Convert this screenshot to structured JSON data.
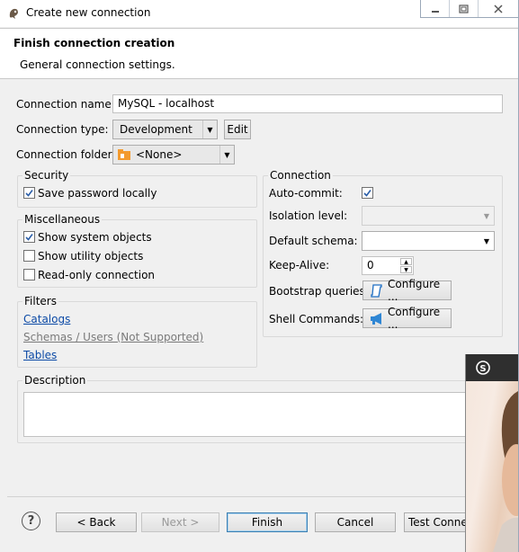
{
  "window": {
    "title": "Create new connection"
  },
  "header": {
    "title": "Finish connection creation",
    "subtitle": "General connection settings."
  },
  "form": {
    "connection_name_label": "Connection name:",
    "connection_name_value": "MySQL - localhost",
    "connection_type_label": "Connection type:",
    "connection_type_value": "Development",
    "edit_label": "Edit",
    "connection_folder_label": "Connection folder:",
    "connection_folder_value": "<None>"
  },
  "security": {
    "title": "Security",
    "save_password_label": "Save password locally",
    "save_password_checked": true
  },
  "misc": {
    "title": "Miscellaneous",
    "items": [
      {
        "label": "Show system objects",
        "checked": true
      },
      {
        "label": "Show utility objects",
        "checked": false
      },
      {
        "label": "Read-only connection",
        "checked": false
      }
    ]
  },
  "filters": {
    "title": "Filters",
    "catalogs": "Catalogs",
    "schemas": "Schemas / Users (Not Supported)",
    "tables": "Tables"
  },
  "connection": {
    "title": "Connection",
    "autocommit_label": "Auto-commit:",
    "autocommit_checked": true,
    "isolation_label": "Isolation level:",
    "isolation_value": "",
    "default_schema_label": "Default schema:",
    "default_schema_value": "",
    "keepalive_label": "Keep-Alive:",
    "keepalive_value": "0",
    "bootstrap_label": "Bootstrap queries:",
    "shell_label": "Shell Commands:",
    "configure_label": "Configure ..."
  },
  "description": {
    "title": "Description",
    "value": ""
  },
  "footer": {
    "help": "?",
    "back": "< Back",
    "next": "Next >",
    "finish": "Finish",
    "cancel": "Cancel",
    "test": "Test Connection"
  },
  "colors": {
    "link": "#0c4aa6",
    "accent": "#3c7fb1",
    "skype": "#00aff0"
  }
}
